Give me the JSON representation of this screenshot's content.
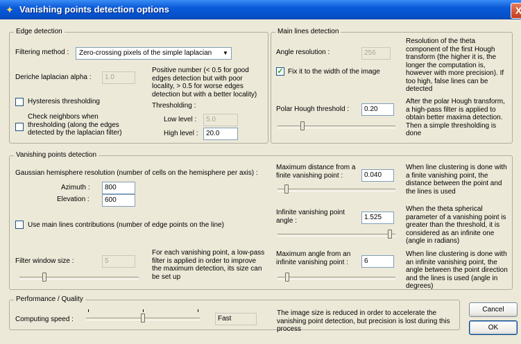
{
  "window": {
    "title": "Vanishing points detection options",
    "close_label": "X"
  },
  "edge": {
    "title": "Edge detection",
    "filter_label": "Filtering method :",
    "filter_value": "Zero-crossing pixels of the simple laplacian",
    "deriche_label": "Deriche laplacian alpha :",
    "deriche_value": "1.0",
    "deriche_desc": "Positive number (< 0.5 for good edges detection but with poor locality, > 0.5 for worse edges detection but with a better locality)",
    "hysteresis_label": "Hysteresis thresholding",
    "hysteresis_checked": false,
    "neighbors_label": "Check neighbors when thresholding (along the edges detected by the laplacian filter)",
    "neighbors_checked": false,
    "thresholding_label": "Thresholding :",
    "low_label": "Low level :",
    "low_value": "5.0",
    "high_label": "High level :",
    "high_value": "20.0"
  },
  "main_lines": {
    "title": "Main lines detection",
    "angle_label": "Angle resolution :",
    "angle_value": "256",
    "angle_desc": "Resolution of the theta component of the first Hough transform (the higher it is, the longer the computation is, however with more precision). If too high, false lines can be detected",
    "fix_label": "Fix it to the width of the image",
    "fix_checked": true,
    "polar_label": "Polar Hough threshold :",
    "polar_value": "0.20",
    "polar_desc": "After the polar Hough transform, a high-pass filter is applied to obtain better maxima detection. Then a simple thresholding is done",
    "polar_slider_level": 0.2
  },
  "vp": {
    "title": "Vanishing points detection",
    "gauss_label": "Gaussian hemisphere resolution (number of cells on the hemisphere per axis) :",
    "azimuth_label": "Azimuth :",
    "azimuth_value": "800",
    "elevation_label": "Elevation :",
    "elevation_value": "600",
    "use_main_label": "Use main lines contributions (number of edge points on the line)",
    "use_main_checked": false,
    "filter_label": "Filter window size :",
    "filter_value": "5",
    "filter_desc": "For each vanishing point, a low-pass filter is applied in order to improve the maximum detection, its size can be set up",
    "filter_slider_level": 0.2,
    "maxdist_label": "Maximum distance from a finite vanishing point :",
    "maxdist_value": "0.040",
    "maxdist_desc": "When line clustering is done with a finite vanishing point, the distance between the point and the lines is used",
    "maxdist_slider_level": 0.06,
    "inf_label": "Infinite vanishing point angle :",
    "inf_value": "1.525",
    "inf_desc": "When the theta spherical parameter of a vanishing point is greater than the threshold, it is considered as an infinite one (angle in radians)",
    "inf_slider_level": 0.97,
    "maxangle_label": "Maximum angle from an infinite vanishing point :",
    "maxangle_value": "6",
    "maxangle_desc": "When line clustering is done with an infinite vanishing point, the angle between the point direction and the lines is used (angle in degrees)",
    "maxangle_slider_level": 0.07
  },
  "perf": {
    "title": "Performance / Quality",
    "speed_label": "Computing speed :",
    "speed_value": "Fast",
    "speed_slider_level": 0.5,
    "desc": "The image size is reduced in order to accelerate the vanishing point detection, but precision is lost during this process"
  },
  "buttons": {
    "cancel": "Cancel",
    "ok": "OK"
  }
}
